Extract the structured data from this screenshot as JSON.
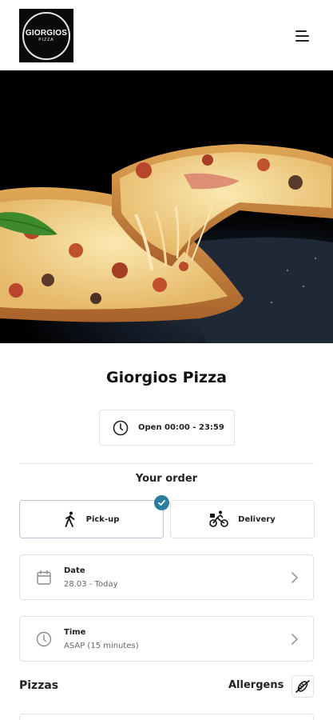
{
  "header": {
    "logo_text": "GIORGIOS",
    "logo_subtext": "PIZZA"
  },
  "restaurant": {
    "name": "Giorgios Pizza",
    "hours": "Open 00:00 - 23:59"
  },
  "order": {
    "heading": "Your order",
    "options": [
      {
        "label": "Pick-up",
        "selected": true
      },
      {
        "label": "Delivery",
        "selected": false
      }
    ],
    "date": {
      "title": "Date",
      "value": "28.03 - Today"
    },
    "time": {
      "title": "Time",
      "value": "ASAP (15 minutes)"
    }
  },
  "menu": {
    "section_title": "Pizzas",
    "allergens_label": "Allergens"
  },
  "colors": {
    "accent": "#2a7e9e",
    "selected_border": "#b7c7d8"
  }
}
